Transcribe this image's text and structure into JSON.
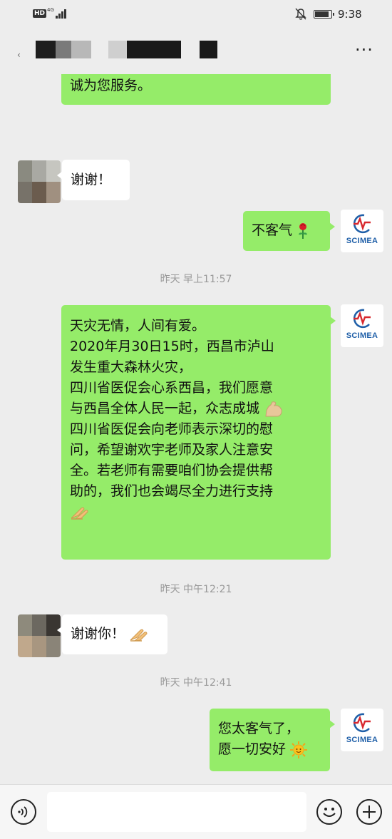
{
  "status_bar": {
    "network_badge": "HD",
    "network_type": "4G",
    "time": "9:38"
  },
  "header": {
    "more_label": "···"
  },
  "messages": [
    {
      "side": "right",
      "lines": [
        "诚为您服务。"
      ]
    },
    {
      "side": "left",
      "lines": [
        "谢谢！"
      ]
    },
    {
      "side": "right",
      "lines": [
        "不客气"
      ],
      "emoji": "rose"
    },
    {
      "type": "timestamp",
      "text": "昨天 早上11:57"
    },
    {
      "side": "right",
      "lines": [
        "天灾无情，人间有爱。",
        "2020年月30日15时，西昌市泸山",
        "发生重大森林火灾，",
        "四川省医促会心系西昌，我们愿意",
        "与西昌全体人民一起，众志成城",
        "四川省医促会向老师表示深切的慰",
        "问，希望谢欢宇老师及家人注意安",
        "全。若老师有需要咱们协会提供帮",
        "助的，我们也会竭尽全力进行支持"
      ],
      "emoji": "muscle, clap"
    },
    {
      "type": "timestamp",
      "text": "昨天 中午12:21"
    },
    {
      "side": "left",
      "lines": [
        "谢谢你！"
      ],
      "emoji": "clap"
    },
    {
      "type": "timestamp",
      "text": "昨天 中午12:41"
    },
    {
      "side": "right",
      "lines": [
        "您太客气了，",
        "愿一切安好"
      ],
      "emoji": "sun"
    }
  ],
  "logo": {
    "text": "SCIMEA",
    "accent": "#d8282e",
    "brand": "#1f5fa8"
  },
  "colors": {
    "bubble_self": "#95ec69",
    "bubble_other": "#ffffff",
    "background": "#ededed"
  },
  "input_bar": {
    "placeholder": ""
  }
}
